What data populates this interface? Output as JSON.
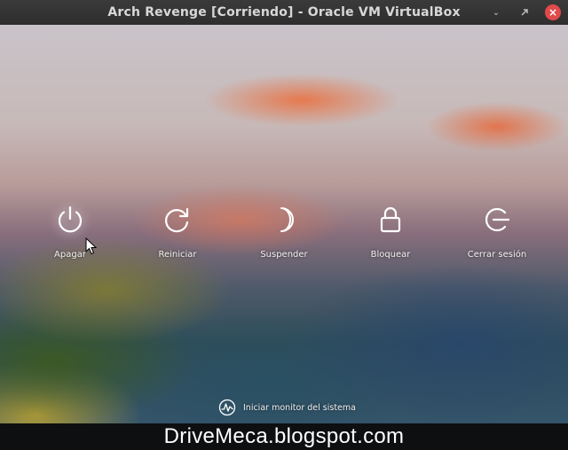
{
  "window": {
    "title": "Arch Revenge [Corriendo] - Oracle VM VirtualBox",
    "controls": {
      "minimize_icon": "minimize-icon",
      "restore_icon": "restore-icon",
      "close_icon": "close-icon"
    }
  },
  "session_menu": {
    "items": [
      {
        "id": "apagar",
        "label": "Apagar",
        "icon": "power-icon",
        "active": true
      },
      {
        "id": "reiniciar",
        "label": "Reiniciar",
        "icon": "restart-icon",
        "active": false
      },
      {
        "id": "suspender",
        "label": "Suspender",
        "icon": "moon-icon",
        "active": false
      },
      {
        "id": "bloquear",
        "label": "Bloquear",
        "icon": "lock-icon",
        "active": false
      },
      {
        "id": "cerrar",
        "label": "Cerrar sesión",
        "icon": "logout-icon",
        "active": false
      }
    ]
  },
  "system_monitor": {
    "label": "Iniciar monitor del sistema",
    "icon": "pulse-monitor-icon"
  },
  "watermark": {
    "text": "DriveMeca.blogspot.com"
  },
  "colors": {
    "titlebar": "#333333",
    "close_button": "#e04a4a",
    "footer_band": "#0d0f10",
    "icon_stroke": "#ffffff"
  }
}
